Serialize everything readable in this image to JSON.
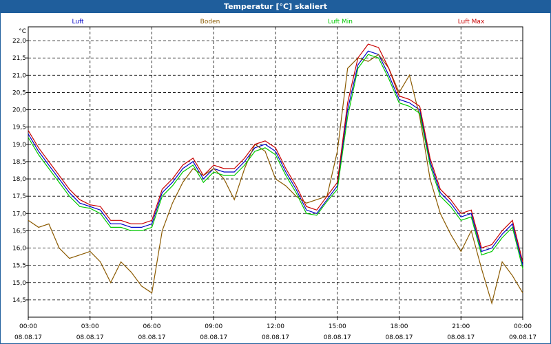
{
  "window": {
    "title": "Temperatur [°C] skaliert"
  },
  "chart_data": {
    "type": "line",
    "title": "Temperatur [°C] skaliert",
    "yunit": "°C",
    "xlim": [
      0,
      24
    ],
    "ylim": [
      14.0,
      22.4
    ],
    "y_ticks": [
      14.5,
      15.0,
      15.5,
      16.0,
      16.5,
      17.0,
      17.5,
      18.0,
      18.5,
      19.0,
      19.5,
      20.0,
      20.5,
      21.0,
      21.5,
      22.0
    ],
    "y_tick_labels": [
      "14,5",
      "15,0",
      "15,5",
      "16,0",
      "16,5",
      "17,0",
      "17,5",
      "18,0",
      "18,5",
      "19,0",
      "19,5",
      "20,0",
      "20,5",
      "21,0",
      "21,5",
      "22,0"
    ],
    "x_ticks": [
      {
        "x": 0,
        "time": "00:00",
        "date": "08.08.17"
      },
      {
        "x": 3,
        "time": "03:00",
        "date": "08.08.17"
      },
      {
        "x": 6,
        "time": "06:00",
        "date": "08.08.17"
      },
      {
        "x": 9,
        "time": "09:00",
        "date": "08.08.17"
      },
      {
        "x": 12,
        "time": "12:00",
        "date": "08.08.17"
      },
      {
        "x": 15,
        "time": "15:00",
        "date": "08.08.17"
      },
      {
        "x": 18,
        "time": "18:00",
        "date": "08.08.17"
      },
      {
        "x": 21,
        "time": "21:00",
        "date": "08.08.17"
      },
      {
        "x": 24,
        "time": "00:00",
        "date": "09.08.17"
      }
    ],
    "grid": true,
    "legend_position": "top",
    "series": [
      {
        "name": "Luft",
        "color": "#0000c8",
        "x": [
          0,
          0.5,
          1,
          1.5,
          2,
          2.5,
          3,
          3.5,
          4,
          4.5,
          5,
          5.5,
          6,
          6.5,
          7,
          7.5,
          8,
          8.5,
          9,
          9.5,
          10,
          10.5,
          11,
          11.5,
          12,
          12.5,
          13,
          13.5,
          14,
          14.5,
          15,
          15.5,
          16,
          16.5,
          17,
          17.5,
          18,
          18.5,
          19,
          19.5,
          20,
          20.5,
          21,
          21.5,
          22,
          22.5,
          23,
          23.5,
          24
        ],
        "y": [
          19.3,
          18.8,
          18.4,
          18.0,
          17.6,
          17.3,
          17.2,
          17.1,
          16.7,
          16.7,
          16.6,
          16.6,
          16.7,
          17.6,
          17.9,
          18.3,
          18.5,
          18.0,
          18.3,
          18.2,
          18.2,
          18.5,
          18.9,
          19.0,
          18.8,
          18.2,
          17.7,
          17.1,
          17.0,
          17.4,
          17.8,
          20.0,
          21.3,
          21.7,
          21.6,
          21.0,
          20.3,
          20.2,
          20.0,
          18.5,
          17.6,
          17.3,
          16.9,
          17.0,
          15.9,
          16.0,
          16.4,
          16.7,
          15.5
        ]
      },
      {
        "name": "Boden",
        "color": "#8b5a00",
        "x": [
          0,
          0.5,
          1,
          1.5,
          2,
          2.5,
          3,
          3.5,
          4,
          4.5,
          5,
          5.5,
          6,
          6.5,
          7,
          7.5,
          8,
          8.5,
          9,
          9.5,
          10,
          10.5,
          11,
          11.5,
          12,
          12.5,
          13,
          13.5,
          14,
          14.5,
          15,
          15.5,
          16,
          16.5,
          17,
          17.5,
          18,
          18.5,
          19,
          19.5,
          20,
          20.5,
          21,
          21.5,
          22,
          22.5,
          23,
          23.5,
          24
        ],
        "y": [
          16.8,
          16.6,
          16.7,
          16.0,
          15.7,
          15.8,
          15.9,
          15.6,
          15.0,
          15.6,
          15.3,
          14.9,
          14.7,
          16.5,
          17.3,
          17.9,
          18.3,
          18.1,
          18.3,
          18.0,
          17.4,
          18.3,
          19.0,
          18.8,
          18.0,
          17.8,
          17.5,
          17.3,
          17.4,
          17.5,
          18.8,
          21.2,
          21.5,
          21.4,
          21.6,
          21.2,
          20.5,
          21.0,
          19.8,
          18.0,
          17.0,
          16.4,
          15.9,
          16.5,
          15.4,
          14.4,
          15.6,
          15.2,
          14.7
        ]
      },
      {
        "name": "Luft Min",
        "color": "#00c800",
        "x": [
          0,
          0.5,
          1,
          1.5,
          2,
          2.5,
          3,
          3.5,
          4,
          4.5,
          5,
          5.5,
          6,
          6.5,
          7,
          7.5,
          8,
          8.5,
          9,
          9.5,
          10,
          10.5,
          11,
          11.5,
          12,
          12.5,
          13,
          13.5,
          14,
          14.5,
          15,
          15.5,
          16,
          16.5,
          17,
          17.5,
          18,
          18.5,
          19,
          19.5,
          20,
          20.5,
          21,
          21.5,
          22,
          22.5,
          23,
          23.5,
          24
        ],
        "y": [
          19.2,
          18.7,
          18.3,
          17.9,
          17.5,
          17.2,
          17.15,
          17.0,
          16.6,
          16.6,
          16.5,
          16.5,
          16.6,
          17.5,
          17.8,
          18.2,
          18.4,
          17.9,
          18.2,
          18.1,
          18.1,
          18.4,
          18.8,
          18.9,
          18.7,
          18.1,
          17.6,
          17.0,
          16.95,
          17.35,
          17.7,
          19.8,
          21.2,
          21.6,
          21.5,
          20.9,
          20.2,
          20.1,
          19.9,
          18.4,
          17.5,
          17.2,
          16.8,
          16.9,
          15.8,
          15.9,
          16.3,
          16.6,
          15.4
        ]
      },
      {
        "name": "Luft Max",
        "color": "#c80000",
        "x": [
          0,
          0.5,
          1,
          1.5,
          2,
          2.5,
          3,
          3.5,
          4,
          4.5,
          5,
          5.5,
          6,
          6.5,
          7,
          7.5,
          8,
          8.5,
          9,
          9.5,
          10,
          10.5,
          11,
          11.5,
          12,
          12.5,
          13,
          13.5,
          14,
          14.5,
          15,
          15.5,
          16,
          16.5,
          17,
          17.5,
          18,
          18.5,
          19,
          19.5,
          20,
          20.5,
          21,
          21.5,
          22,
          22.5,
          23,
          23.5,
          24
        ],
        "y": [
          19.4,
          18.9,
          18.5,
          18.1,
          17.7,
          17.4,
          17.25,
          17.2,
          16.8,
          16.8,
          16.7,
          16.7,
          16.8,
          17.7,
          18.0,
          18.4,
          18.6,
          18.1,
          18.4,
          18.3,
          18.3,
          18.6,
          19.0,
          19.1,
          18.9,
          18.3,
          17.8,
          17.2,
          17.1,
          17.5,
          17.9,
          20.2,
          21.5,
          21.9,
          21.8,
          21.2,
          20.4,
          20.3,
          20.1,
          18.6,
          17.7,
          17.4,
          17.0,
          17.1,
          16.0,
          16.1,
          16.5,
          16.8,
          15.6
        ]
      }
    ]
  }
}
